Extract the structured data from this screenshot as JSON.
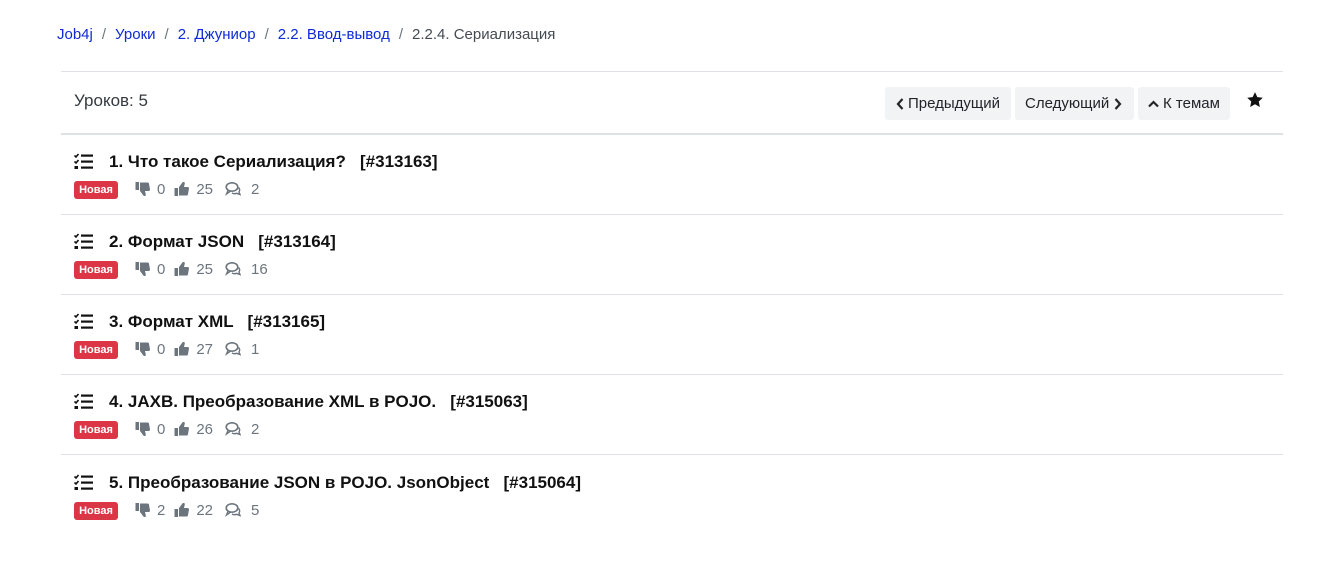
{
  "breadcrumb": {
    "items": [
      "Job4j",
      "Уроки",
      "2. Джуниор",
      "2.2. Ввод-вывод"
    ],
    "separator": "/",
    "current": "2.2.4. Сериализация"
  },
  "toolbar": {
    "count_label": "Уроков: 5",
    "prev_label": "Предыдущий",
    "next_label": "Следующий",
    "themes_label": "К темам"
  },
  "lessons": [
    {
      "title": "1. Что такое Сериализация?   [#313163]",
      "badge": "Новая",
      "dislikes": "0",
      "likes": "25",
      "comments": "2"
    },
    {
      "title": "2. Формат JSON   [#313164]",
      "badge": "Новая",
      "dislikes": "0",
      "likes": "25",
      "comments": "16"
    },
    {
      "title": "3. Формат XML   [#313165]",
      "badge": "Новая",
      "dislikes": "0",
      "likes": "27",
      "comments": "1"
    },
    {
      "title": "4. JAXB. Преобразование XML в POJO.   [#315063]",
      "badge": "Новая",
      "dislikes": "0",
      "likes": "26",
      "comments": "2"
    },
    {
      "title": "5. Преобразование JSON в POJO. JsonObject   [#315064]",
      "badge": "Новая",
      "dislikes": "2",
      "likes": "22",
      "comments": "5"
    }
  ],
  "colors": {
    "link": "#0d2bd6",
    "badge": "#dc3545",
    "button_bg": "#f1f3f5"
  }
}
